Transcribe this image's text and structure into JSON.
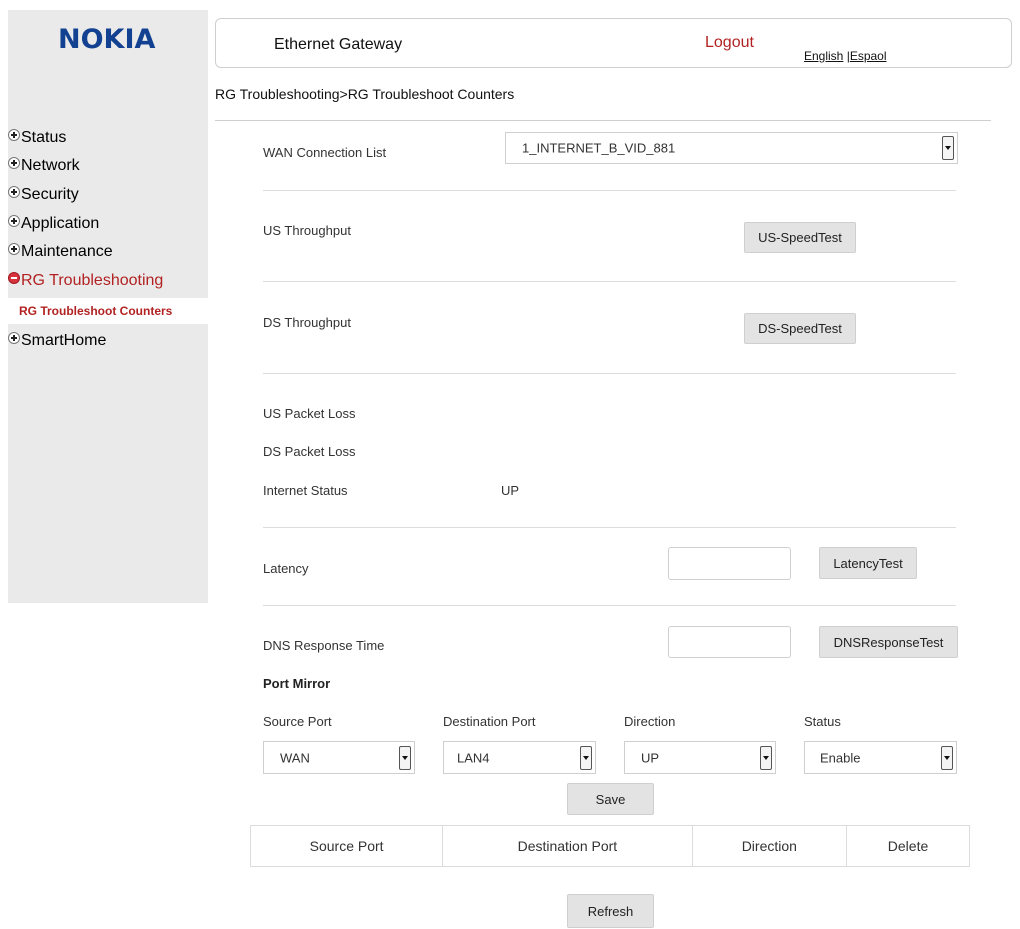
{
  "brand": {
    "logo_text": "NOKIA",
    "brand_color": "#124191"
  },
  "header": {
    "title": "Ethernet Gateway",
    "logout": "Logout",
    "lang_english": "English",
    "lang_sep": " |",
    "lang_espanol": "Espaol"
  },
  "breadcrumb": "RG Troubleshooting>RG Troubleshoot Counters",
  "sidebar": {
    "items": [
      {
        "label": "Status",
        "icon": "plus-icon"
      },
      {
        "label": "Network",
        "icon": "plus-icon"
      },
      {
        "label": "Security",
        "icon": "plus-icon"
      },
      {
        "label": "Application",
        "icon": "plus-icon"
      },
      {
        "label": "Maintenance",
        "icon": "plus-icon"
      },
      {
        "label": "RG Troubleshooting",
        "icon": "minus-icon",
        "active": true
      },
      {
        "label": "SmartHome",
        "icon": "plus-icon"
      }
    ],
    "sub_item": "RG Troubleshoot Counters",
    "active_color": "#b22222"
  },
  "form": {
    "wan_label": "WAN Connection List",
    "wan_value": "1_INTERNET_B_VID_881",
    "us_throughput_label": "US Throughput",
    "us_speedtest_button": "US-SpeedTest",
    "ds_throughput_label": "DS Throughput",
    "ds_speedtest_button": "DS-SpeedTest",
    "us_packet_loss_label": "US Packet Loss",
    "ds_packet_loss_label": "DS Packet Loss",
    "internet_status_label": "Internet Status",
    "internet_status_value": "UP",
    "latency_label": "Latency",
    "latency_value": "",
    "latency_button": "LatencyTest",
    "dns_label": "DNS Response Time",
    "dns_value": "",
    "dns_button": "DNSResponseTest"
  },
  "port_mirror": {
    "title": "Port Mirror",
    "source_label": "Source Port",
    "source_value": "WAN",
    "destination_label": "Destination Port",
    "destination_value": "LAN4",
    "direction_label": "Direction",
    "direction_value": "UP",
    "status_label": "Status",
    "status_value": "Enable",
    "save_button": "Save",
    "table_headers": [
      "Source Port",
      "Destination Port",
      "Direction",
      "Delete"
    ],
    "refresh_button": "Refresh"
  }
}
